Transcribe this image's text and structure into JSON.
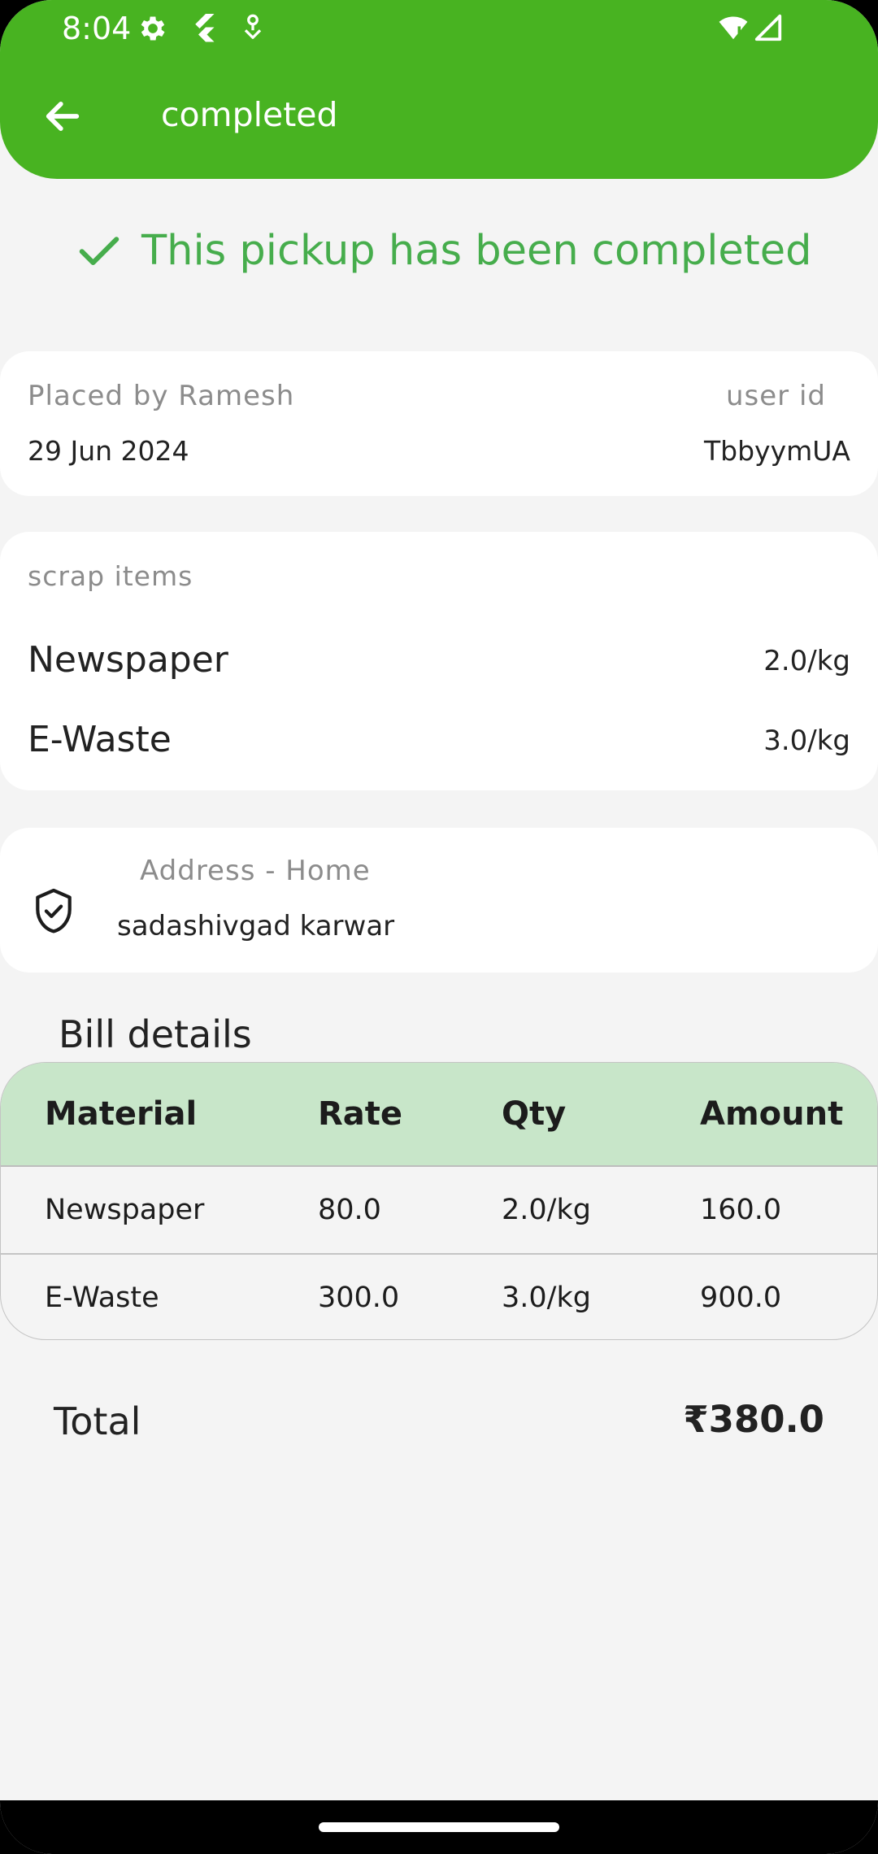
{
  "status_bar": {
    "time": "8:04",
    "icons": [
      "settings-icon",
      "flutter-icon",
      "debug-icon",
      "wifi-icon",
      "signal-icon"
    ]
  },
  "app_bar": {
    "back_icon": "arrow-back-icon",
    "title": "completed"
  },
  "banner": {
    "icon": "check-icon",
    "text": "This pickup has been completed"
  },
  "order": {
    "placed_by": "Placed by Ramesh",
    "date": "29 Jun 2024",
    "user_id_label": "user id",
    "user_id": "TbbyymUA"
  },
  "scrap": {
    "heading": "scrap items",
    "items": [
      {
        "name": "Newspaper",
        "qty": "2.0/kg"
      },
      {
        "name": "E-Waste",
        "qty": "3.0/kg"
      }
    ]
  },
  "address": {
    "icon": "shield-check-icon",
    "label": "Address - Home",
    "line": "sadashivgad karwar"
  },
  "bill": {
    "title": "Bill details",
    "headers": {
      "material": "Material",
      "rate": "Rate",
      "qty": "Qty",
      "amount": "Amount"
    },
    "rows": [
      {
        "material": "Newspaper",
        "rate": "80.0",
        "qty": "2.0/kg",
        "amount": "160.0"
      },
      {
        "material": "E-Waste",
        "rate": "300.0",
        "qty": "3.0/kg",
        "amount": "900.0"
      }
    ]
  },
  "total": {
    "label": "Total",
    "value": "₹380.0"
  },
  "colors": {
    "app_bar": "#48b321",
    "accent_green": "#46ad4c",
    "table_header": "#c8e6c9",
    "background": "#f4f4f4"
  }
}
